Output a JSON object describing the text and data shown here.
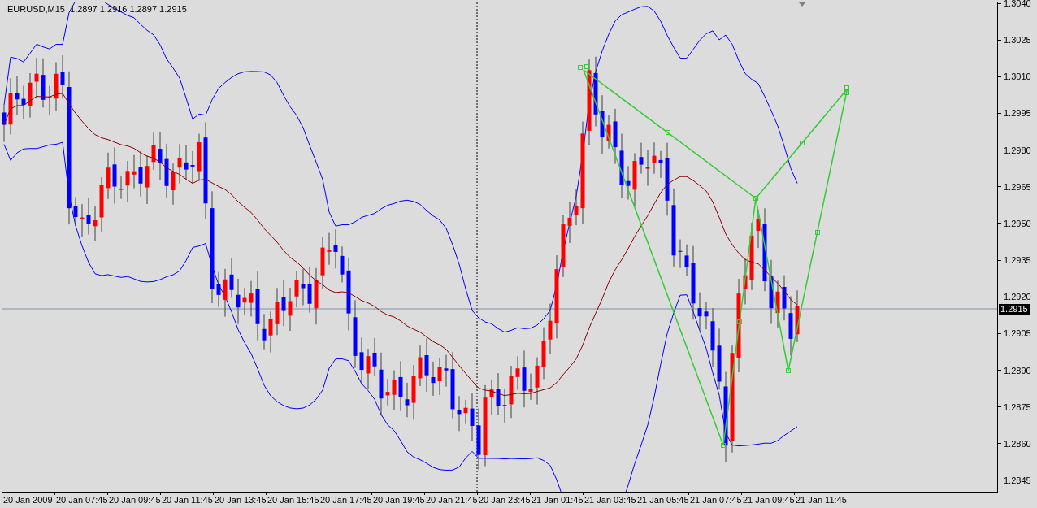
{
  "chart": {
    "title": "EURUSD,M15  1.2897 1.2916 1.2897 1.2915",
    "price_axis": {
      "ticks": [
        "1.3040",
        "1.3025",
        "1.3010",
        "1.2995",
        "1.2980",
        "1.2965",
        "1.2950",
        "1.2935",
        "1.2920",
        "1.2905",
        "1.2890",
        "1.2875",
        "1.2860",
        "1.2845"
      ],
      "current_price": "1.2915"
    },
    "time_axis": {
      "ticks": [
        "20 Jan 2009",
        "20 Jan 07:45",
        "20 Jan 09:45",
        "20 Jan 11:45",
        "20 Jan 13:45",
        "20 Jan 15:45",
        "20 Jan 17:45",
        "20 Jan 19:45",
        "20 Jan 21:45",
        "20 Jan 23:45",
        "21 Jan 01:45",
        "21 Jan 03:45",
        "21 Jan 05:45",
        "21 Jan 07:45",
        "21 Jan 09:45",
        "21 Jan 11:45"
      ]
    }
  }
}
